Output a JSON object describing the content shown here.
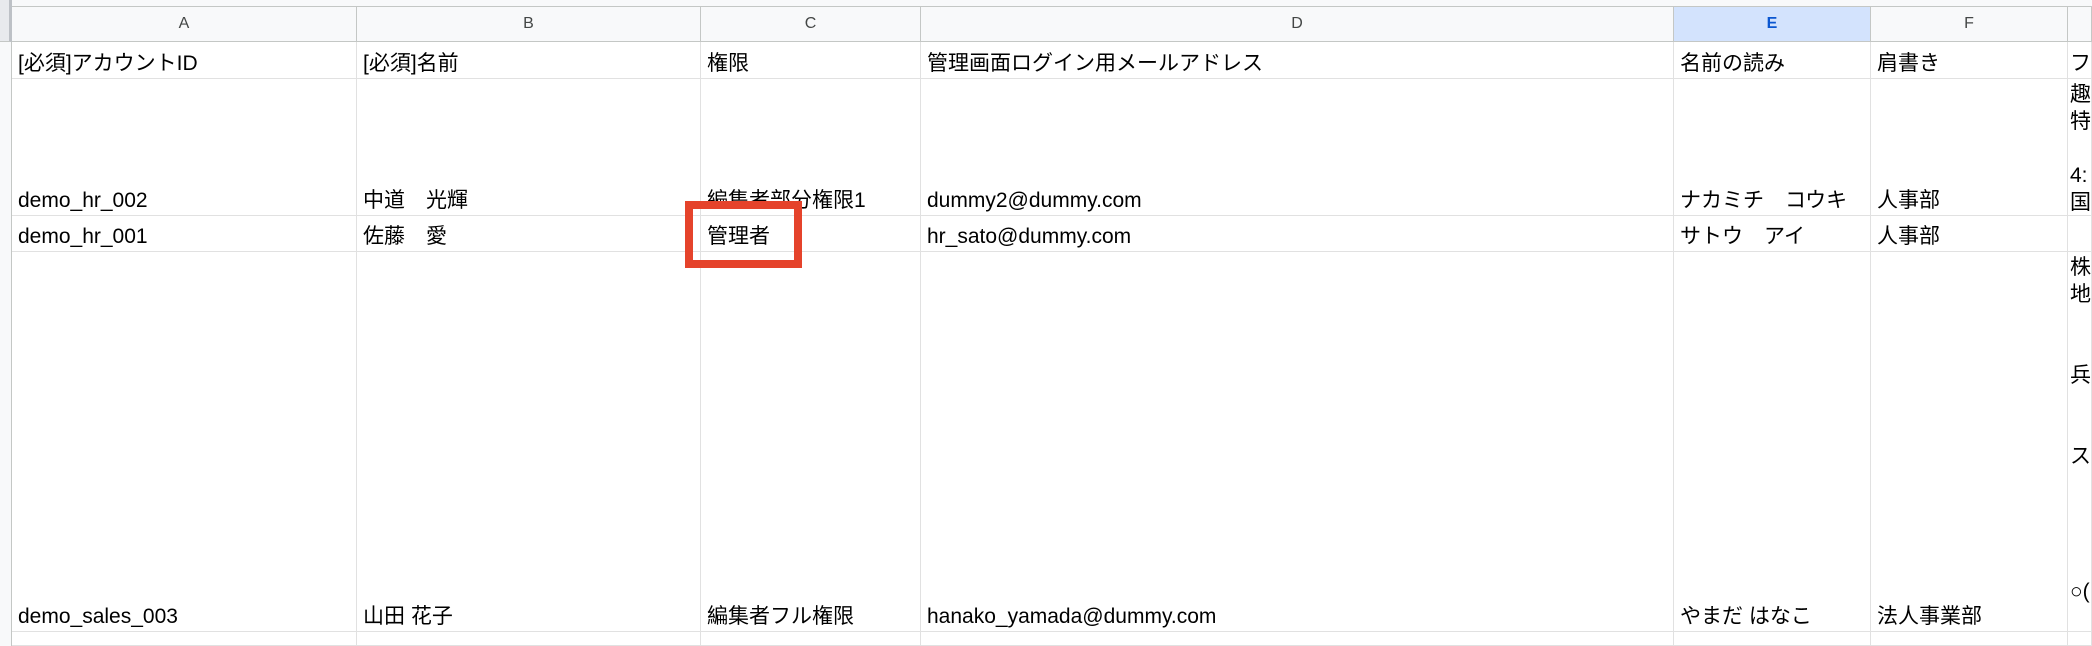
{
  "columns": [
    "A",
    "B",
    "C",
    "D",
    "E",
    "F",
    "フ"
  ],
  "selected_column": "E",
  "header_row": {
    "a": "[必須]アカウントID",
    "b": "[必須]名前",
    "c": "権限",
    "d": "管理画面ログイン用メールアドレス",
    "e": "名前の読み",
    "f": "肩書き",
    "g": "フ"
  },
  "rows": [
    {
      "account_id": "demo_hr_002",
      "name": "中道　光輝",
      "permission": "編集者部分権限1",
      "email": "dummy2@dummy.com",
      "reading": "ナカミチ　コウキ",
      "title": "人事部",
      "profile_fragment": "趣\n特\n\n4:\n国"
    },
    {
      "account_id": "demo_hr_001",
      "name": "佐藤　愛",
      "permission": "管理者",
      "email": "hr_sato@dummy.com",
      "reading": "サトウ　アイ",
      "title": "人事部",
      "profile_fragment": ""
    },
    {
      "account_id": "demo_sales_003",
      "name": "山田 花子",
      "permission": "編集者フル権限",
      "email": "hanako_yamada@dummy.com",
      "reading": "やまだ はなこ",
      "title": "法人事業部",
      "profile_fragment": "株\n地\n\n　|\n兵\n\n　|\nス\n　(\n\n\n　|\n○("
    }
  ],
  "colors": {
    "highlight": "#e5432b",
    "selected_header_bg": "#d3e3fd",
    "selected_header_text": "#0b57d0"
  }
}
